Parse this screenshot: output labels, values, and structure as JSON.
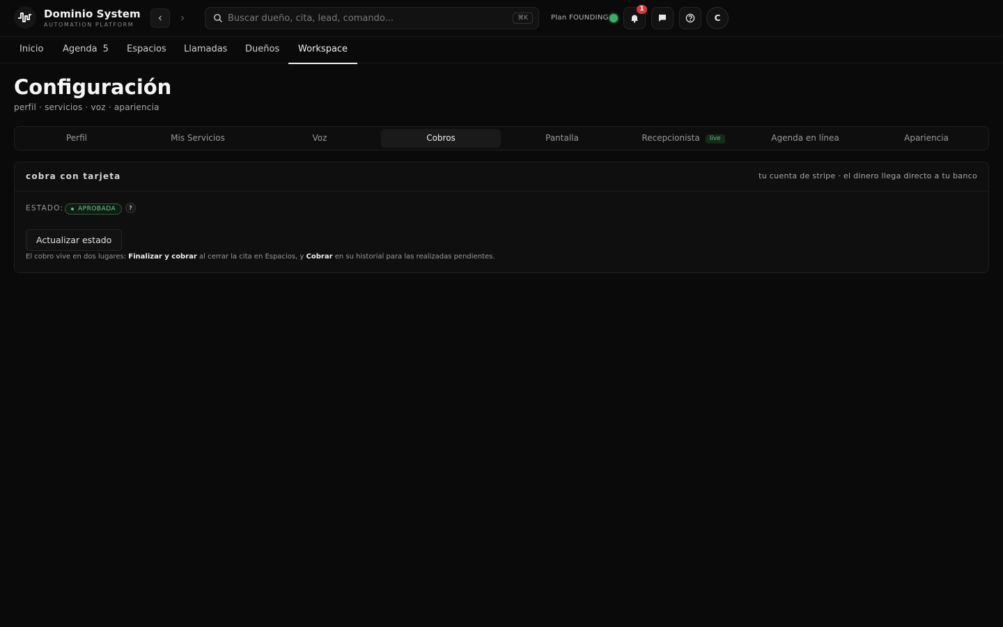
{
  "brand": {
    "name": "Dominio System",
    "subtitle": "AUTOMATION PLATFORM"
  },
  "search": {
    "placeholder": "Buscar dueño, cita, lead, comando...",
    "shortcut": "⌘K"
  },
  "plan": {
    "label": "Plan FOUNDING",
    "status_color": "#3fae64"
  },
  "notifications": {
    "count": "1"
  },
  "user": {
    "initial": "C"
  },
  "main_tabs": [
    {
      "label": "Inicio"
    },
    {
      "label": "Agenda",
      "count": "5"
    },
    {
      "label": "Espacios"
    },
    {
      "label": "Llamadas"
    },
    {
      "label": "Dueños"
    },
    {
      "label": "Workspace",
      "active": true
    }
  ],
  "page": {
    "title": "Configuración",
    "subtitle": "perfil · servicios · voz · apariencia"
  },
  "settings_tabs": [
    {
      "label": "Perfil"
    },
    {
      "label": "Mis Servicios"
    },
    {
      "label": "Voz"
    },
    {
      "label": "Cobros",
      "active": true
    },
    {
      "label": "Pantalla"
    },
    {
      "label": "Recepcionista",
      "badge": "live"
    },
    {
      "label": "Agenda en línea"
    },
    {
      "label": "Apariencia"
    }
  ],
  "card": {
    "title": "cobra con tarjeta",
    "note": "tu cuenta de stripe · el dinero llega directo a tu banco",
    "estado_label": "ESTADO:",
    "status": "APROBADA",
    "help_mark": "?",
    "update_button": "Actualizar estado",
    "help_text": {
      "part1": "El cobro vive en dos lugares: ",
      "bold1": "Finalizar y cobrar",
      "part2": " al cerrar la cita en Espacios, y ",
      "bold2": "Cobrar",
      "part3": " en su historial para las realizadas pendientes."
    }
  },
  "colors": {
    "accent_green": "#5fbf7f",
    "badge_red": "#d23a3a",
    "background": "#0a0a0a"
  }
}
